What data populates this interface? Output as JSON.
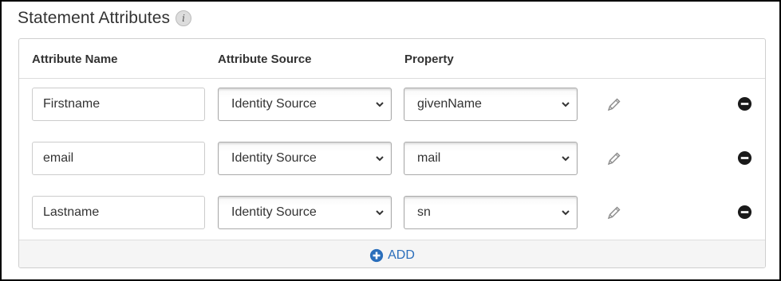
{
  "section": {
    "title": "Statement Attributes",
    "info_icon": "info-icon",
    "info_glyph": "i"
  },
  "columns": {
    "name": "Attribute Name",
    "source": "Attribute Source",
    "property": "Property"
  },
  "rows": [
    {
      "name": "Firstname",
      "source": "Identity Source",
      "property": "givenName"
    },
    {
      "name": "email",
      "source": "Identity Source",
      "property": "mail"
    },
    {
      "name": "Lastname",
      "source": "Identity Source",
      "property": "sn"
    }
  ],
  "add_label": "ADD",
  "colors": {
    "accent": "#2a6ebb",
    "text": "#333333",
    "border": "#cfcfcf"
  }
}
